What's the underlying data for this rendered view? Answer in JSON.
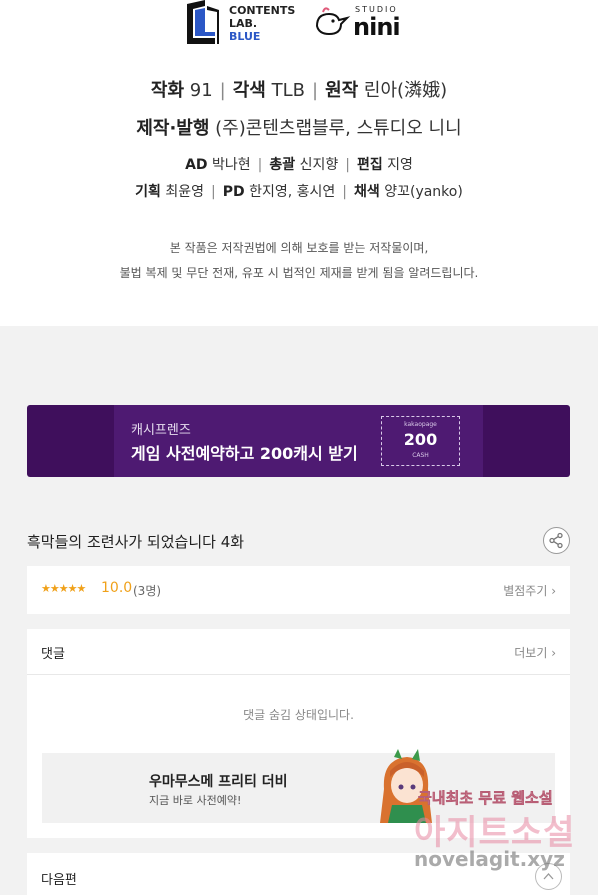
{
  "credits": {
    "logo_cl_lines": [
      "CONTENTS",
      "LAB.",
      "BLUE"
    ],
    "logo_nini_small": "STUDIO",
    "logo_nini_big": "nini",
    "line1": [
      {
        "label": "작화",
        "value": "91"
      },
      {
        "label": "각색",
        "value": "TLB"
      },
      {
        "label": "원작",
        "value": "린아(潾娥)"
      }
    ],
    "line2": {
      "label": "제작·발행",
      "value": "(주)콘텐츠랩블루, 스튜디오 니니"
    },
    "line3": [
      {
        "label": "AD",
        "value": "박나현"
      },
      {
        "label": "총괄",
        "value": "신지향"
      },
      {
        "label": "편집",
        "value": "지영"
      }
    ],
    "line4": [
      {
        "label": "기획",
        "value": "최윤영"
      },
      {
        "label": "PD",
        "value": "한지영, 홍시연"
      },
      {
        "label": "채색",
        "value": "양꼬(yanko)"
      }
    ],
    "separator": "|",
    "notice_line1": "본 작품은 저작권법에 의해 보호를 받는 저작물이며,",
    "notice_line2": "불법 복제 및 무단 전재, 유포 시 법적인 제재를 받게 됨을 알려드립니다."
  },
  "banner": {
    "subtitle": "캐시프렌즈",
    "title": "게임 사전예약하고 200캐시 받기",
    "coupon_top": "kakaopage",
    "coupon_amount": "200",
    "coupon_unit": "CASH",
    "colors": {
      "bg": "#3f0f5c",
      "inner": "#4e1a72"
    }
  },
  "episode": {
    "title": "흑막들의 조련사가 되었습니다 4화",
    "share_icon": "share-icon"
  },
  "rating": {
    "stars": "★★★★★",
    "star_value": 5,
    "score": "10.0",
    "count": "(3명)",
    "rate_button": "별점주기 ›"
  },
  "comments": {
    "header": "댓글",
    "more": "더보기 ›",
    "hidden_text": "댓글 숨김 상태입니다."
  },
  "ad": {
    "title": "우마무스메 프리티 더비",
    "subtitle": "지금 바로 사전예약!"
  },
  "next": {
    "label": "다음편"
  },
  "watermark": {
    "line1": "국내최초 무료 웹소설",
    "line2": "아지트소설",
    "line3": "novelagit.xyz"
  }
}
